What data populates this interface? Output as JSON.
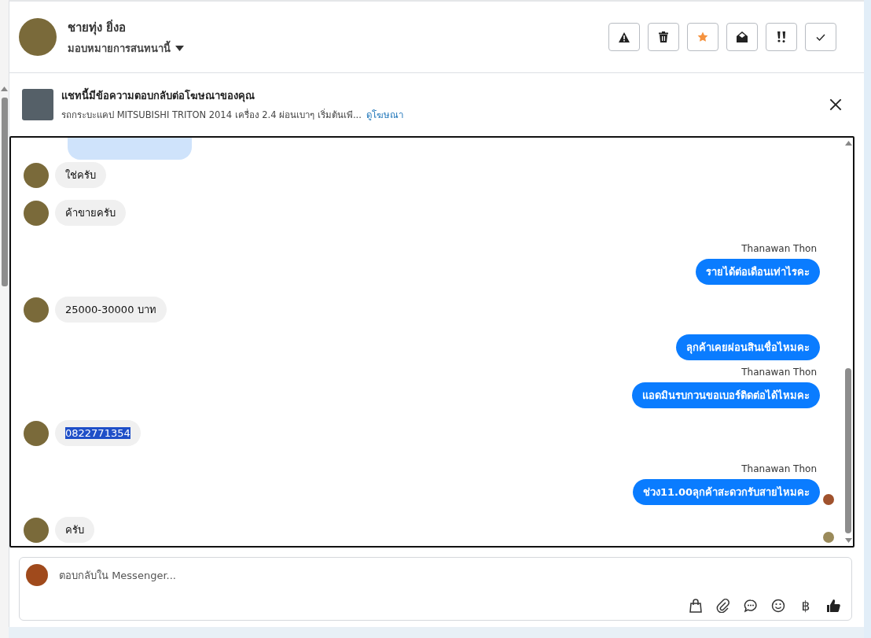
{
  "header": {
    "contact_name": "ชายทุ่ง ยิ่งอ",
    "assign_label": "มอบหมายการสนทนานี้",
    "starred": true,
    "actions": [
      {
        "kind": "spam"
      },
      {
        "kind": "delete"
      },
      {
        "kind": "star"
      },
      {
        "kind": "unread"
      },
      {
        "kind": "important"
      },
      {
        "kind": "done"
      }
    ]
  },
  "ad_banner": {
    "title": "แชทนี้มีข้อความตอบกลับต่อโฆษณาของคุณ",
    "description": "รถกระบะแคป MITSUBISHI TRITON 2014 เครื่อง 2.4 ผ่อนเบาๆ เริ่มต้นเพี...",
    "link": "ดูโฆษณา"
  },
  "messages": [
    {
      "kind": "incoming",
      "text": "ใช่ครับ",
      "highlighted": false,
      "seen": false
    },
    {
      "kind": "incoming",
      "text": "ค้าขายครับ",
      "highlighted": false,
      "seen": false
    },
    {
      "kind": "outgoing",
      "sender": "Thanawan Thon",
      "text": "รายได้ต่อเดือนเท่าไรคะ",
      "seen": false
    },
    {
      "kind": "incoming",
      "text": "25000-30000 บาท",
      "highlighted": false,
      "seen": false
    },
    {
      "kind": "outgoing",
      "text": "ลุกค้าเคยผ่อนสินเชื่อไหมคะ",
      "seen": false
    },
    {
      "kind": "outgoing",
      "sender": "Thanawan Thon",
      "text": "แอดมินรบกวนขอเบอร์ติดต่อได้ไหมคะ",
      "seen": false
    },
    {
      "kind": "incoming",
      "text": "0822771354",
      "highlighted": true,
      "seen": false
    },
    {
      "kind": "outgoing",
      "sender": "Thanawan Thon",
      "text": "ช่วง11.00ลุกค้าสะดวกรับสายไหมคะ",
      "seen": true
    },
    {
      "kind": "incoming",
      "text": "ครับ",
      "highlighted": false,
      "seen": true
    }
  ],
  "composer": {
    "placeholder": "ตอบกลับใน Messenger...",
    "currency_symbol": "฿"
  }
}
